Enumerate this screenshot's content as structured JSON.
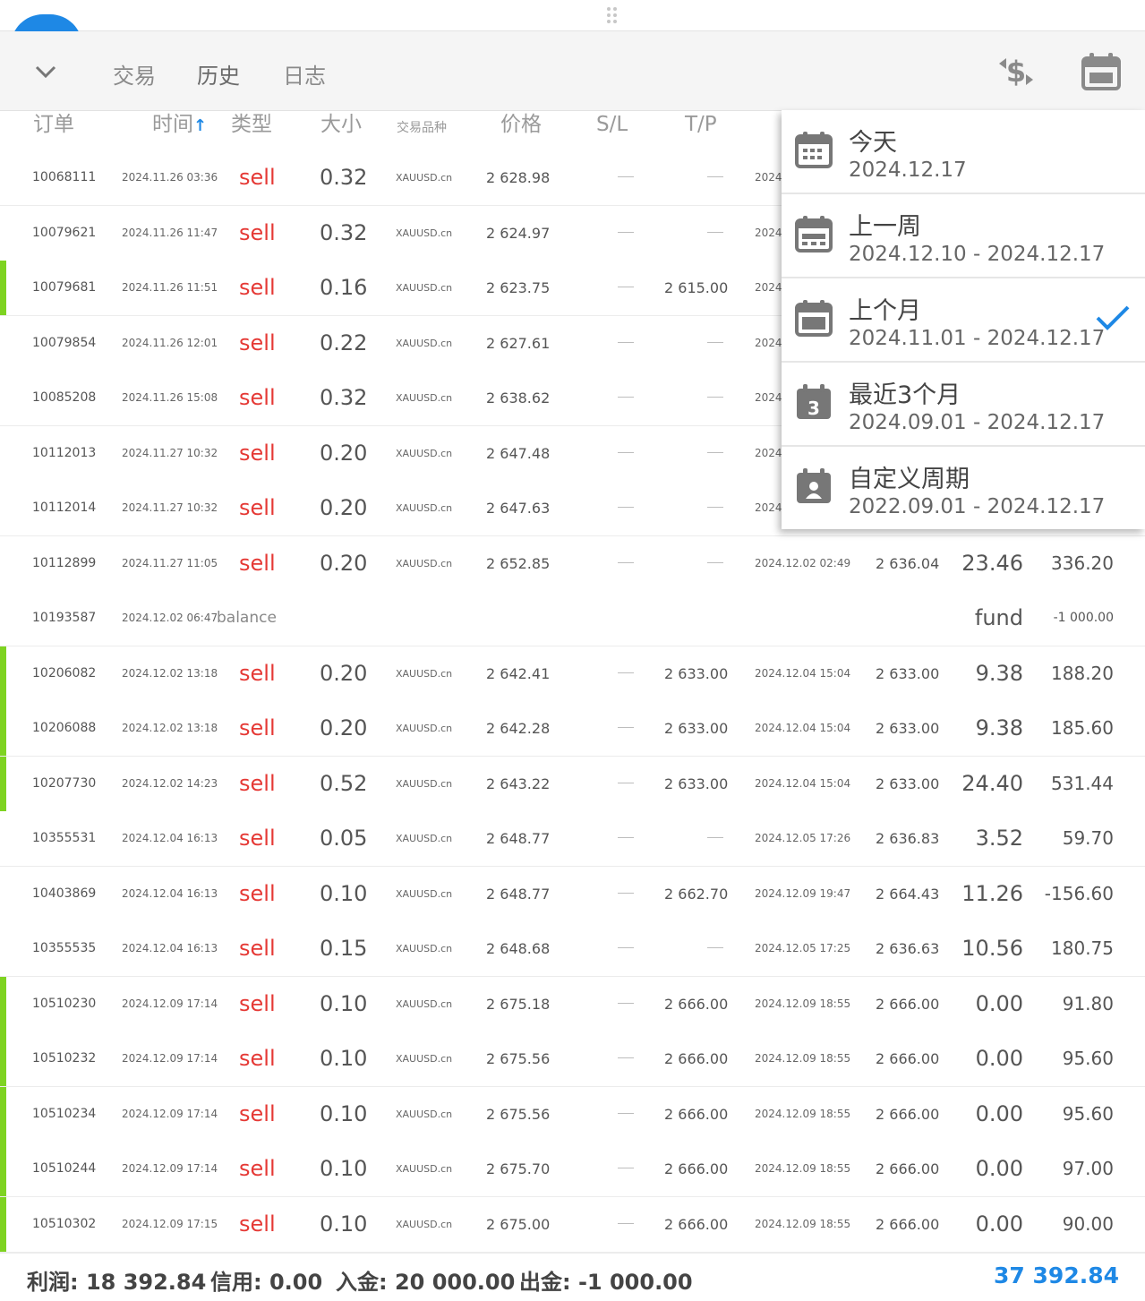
{
  "toolbar": {
    "tabs": [
      {
        "label": "交易"
      },
      {
        "label": "历史"
      },
      {
        "label": "日志"
      }
    ],
    "active_tab": "历史",
    "icons": [
      "chevron-down-icon",
      "dollar-exchange-icon",
      "calendar-icon"
    ]
  },
  "columns": {
    "order": "订单",
    "time": "时间",
    "type": "类型",
    "size": "大小",
    "symbol": "交易品种",
    "price": "价格",
    "sl": "S/L",
    "tp": "T/P",
    "sort_arrow": "↑"
  },
  "rows": [
    {
      "order": "10068111",
      "time": "2024.11.26 03:36",
      "type": "sell",
      "size": "0.32",
      "symbol": "XAUUSD.cn",
      "price": "2 628.98",
      "sl": "—",
      "tp": "—",
      "close_time": "2024",
      "close_price": "",
      "swap": "",
      "profit": "",
      "bar": false
    },
    {
      "order": "10079621",
      "time": "2024.11.26 11:47",
      "type": "sell",
      "size": "0.32",
      "symbol": "XAUUSD.cn",
      "price": "2 624.97",
      "sl": "—",
      "tp": "—",
      "close_time": "2024",
      "close_price": "",
      "swap": "",
      "profit": "",
      "bar": false
    },
    {
      "order": "10079681",
      "time": "2024.11.26 11:51",
      "type": "sell",
      "size": "0.16",
      "symbol": "XAUUSD.cn",
      "price": "2 623.75",
      "sl": "—",
      "tp": "2 615.00",
      "close_time": "2024",
      "close_price": "",
      "swap": "",
      "profit": "",
      "bar": true
    },
    {
      "order": "10079854",
      "time": "2024.11.26 12:01",
      "type": "sell",
      "size": "0.22",
      "symbol": "XAUUSD.cn",
      "price": "2 627.61",
      "sl": "—",
      "tp": "—",
      "close_time": "2024",
      "close_price": "",
      "swap": "",
      "profit": "",
      "bar": false
    },
    {
      "order": "10085208",
      "time": "2024.11.26 15:08",
      "type": "sell",
      "size": "0.32",
      "symbol": "XAUUSD.cn",
      "price": "2 638.62",
      "sl": "—",
      "tp": "—",
      "close_time": "2024",
      "close_price": "",
      "swap": "",
      "profit": "",
      "bar": false
    },
    {
      "order": "10112013",
      "time": "2024.11.27 10:32",
      "type": "sell",
      "size": "0.20",
      "symbol": "XAUUSD.cn",
      "price": "2 647.48",
      "sl": "—",
      "tp": "—",
      "close_time": "2024",
      "close_price": "",
      "swap": "",
      "profit": "",
      "bar": false
    },
    {
      "order": "10112014",
      "time": "2024.11.27 10:32",
      "type": "sell",
      "size": "0.20",
      "symbol": "XAUUSD.cn",
      "price": "2 647.63",
      "sl": "—",
      "tp": "—",
      "close_time": "2024",
      "close_price": "",
      "swap": "",
      "profit": "",
      "bar": false
    },
    {
      "order": "10112899",
      "time": "2024.11.27 11:05",
      "type": "sell",
      "size": "0.20",
      "symbol": "XAUUSD.cn",
      "price": "2 652.85",
      "sl": "—",
      "tp": "—",
      "close_time": "2024.12.02 02:49",
      "close_price": "2 636.04",
      "swap": "23.46",
      "profit": "336.20",
      "bar": false
    },
    {
      "order": "10193587",
      "time": "2024.12.02 06:47",
      "type": "balance",
      "size": "",
      "symbol": "",
      "price": "",
      "sl": "",
      "tp": "",
      "close_time": "",
      "close_price": "",
      "swap": "fund",
      "profit": "-1 000.00",
      "bar": false
    },
    {
      "order": "10206082",
      "time": "2024.12.02 13:18",
      "type": "sell",
      "size": "0.20",
      "symbol": "XAUUSD.cn",
      "price": "2 642.41",
      "sl": "—",
      "tp": "2 633.00",
      "close_time": "2024.12.04 15:04",
      "close_price": "2 633.00",
      "swap": "9.38",
      "profit": "188.20",
      "bar": true
    },
    {
      "order": "10206088",
      "time": "2024.12.02 13:18",
      "type": "sell",
      "size": "0.20",
      "symbol": "XAUUSD.cn",
      "price": "2 642.28",
      "sl": "—",
      "tp": "2 633.00",
      "close_time": "2024.12.04 15:04",
      "close_price": "2 633.00",
      "swap": "9.38",
      "profit": "185.60",
      "bar": true
    },
    {
      "order": "10207730",
      "time": "2024.12.02 14:23",
      "type": "sell",
      "size": "0.52",
      "symbol": "XAUUSD.cn",
      "price": "2 643.22",
      "sl": "—",
      "tp": "2 633.00",
      "close_time": "2024.12.04 15:04",
      "close_price": "2 633.00",
      "swap": "24.40",
      "profit": "531.44",
      "bar": true
    },
    {
      "order": "10355531",
      "time": "2024.12.04 16:13",
      "type": "sell",
      "size": "0.05",
      "symbol": "XAUUSD.cn",
      "price": "2 648.77",
      "sl": "—",
      "tp": "—",
      "close_time": "2024.12.05 17:26",
      "close_price": "2 636.83",
      "swap": "3.52",
      "profit": "59.70",
      "bar": false
    },
    {
      "order": "10403869",
      "time": "2024.12.04 16:13",
      "type": "sell",
      "size": "0.10",
      "symbol": "XAUUSD.cn",
      "price": "2 648.77",
      "sl": "—",
      "tp": "2 662.70",
      "close_time": "2024.12.09 19:47",
      "close_price": "2 664.43",
      "swap": "11.26",
      "profit": "-156.60",
      "bar": false
    },
    {
      "order": "10355535",
      "time": "2024.12.04 16:13",
      "type": "sell",
      "size": "0.15",
      "symbol": "XAUUSD.cn",
      "price": "2 648.68",
      "sl": "—",
      "tp": "—",
      "close_time": "2024.12.05 17:25",
      "close_price": "2 636.63",
      "swap": "10.56",
      "profit": "180.75",
      "bar": false
    },
    {
      "order": "10510230",
      "time": "2024.12.09 17:14",
      "type": "sell",
      "size": "0.10",
      "symbol": "XAUUSD.cn",
      "price": "2 675.18",
      "sl": "—",
      "tp": "2 666.00",
      "close_time": "2024.12.09 18:55",
      "close_price": "2 666.00",
      "swap": "0.00",
      "profit": "91.80",
      "bar": true
    },
    {
      "order": "10510232",
      "time": "2024.12.09 17:14",
      "type": "sell",
      "size": "0.10",
      "symbol": "XAUUSD.cn",
      "price": "2 675.56",
      "sl": "—",
      "tp": "2 666.00",
      "close_time": "2024.12.09 18:55",
      "close_price": "2 666.00",
      "swap": "0.00",
      "profit": "95.60",
      "bar": true
    },
    {
      "order": "10510234",
      "time": "2024.12.09 17:14",
      "type": "sell",
      "size": "0.10",
      "symbol": "XAUUSD.cn",
      "price": "2 675.56",
      "sl": "—",
      "tp": "2 666.00",
      "close_time": "2024.12.09 18:55",
      "close_price": "2 666.00",
      "swap": "0.00",
      "profit": "95.60",
      "bar": true
    },
    {
      "order": "10510244",
      "time": "2024.12.09 17:14",
      "type": "sell",
      "size": "0.10",
      "symbol": "XAUUSD.cn",
      "price": "2 675.70",
      "sl": "—",
      "tp": "2 666.00",
      "close_time": "2024.12.09 18:55",
      "close_price": "2 666.00",
      "swap": "0.00",
      "profit": "97.00",
      "bar": true
    },
    {
      "order": "10510302",
      "time": "2024.12.09 17:15",
      "type": "sell",
      "size": "0.10",
      "symbol": "XAUUSD.cn",
      "price": "2 675.00",
      "sl": "—",
      "tp": "2 666.00",
      "close_time": "2024.12.09 18:55",
      "close_price": "2 666.00",
      "swap": "0.00",
      "profit": "90.00",
      "bar": true
    }
  ],
  "dropdown": {
    "options": [
      {
        "label": "今天",
        "range": "2024.12.17",
        "icon": "calendar-grid-icon",
        "selected": false
      },
      {
        "label": "上一周",
        "range": "2024.12.10 - 2024.12.17",
        "icon": "calendar-week-icon",
        "selected": false
      },
      {
        "label": "上个月",
        "range": "2024.11.01 - 2024.12.17",
        "icon": "calendar-month-icon",
        "selected": true
      },
      {
        "label": "最近3个月",
        "range": "2024.09.01 - 2024.12.17",
        "icon": "calendar-3-icon",
        "selected": false
      },
      {
        "label": "自定义周期",
        "range": "2022.09.01 - 2024.12.17",
        "icon": "calendar-person-icon",
        "selected": false
      }
    ]
  },
  "footer": {
    "profit": "利润: 18 392.84",
    "credit": "信用: 0.00",
    "deposit": "入金: 20 000.00",
    "withdrawal": "出金: -1 000.00",
    "total": "37 392.84"
  },
  "colors": {
    "sell": "#e53935",
    "accent": "#1e88e5",
    "row_marker": "#7ed321",
    "check": "#1e88e5"
  }
}
